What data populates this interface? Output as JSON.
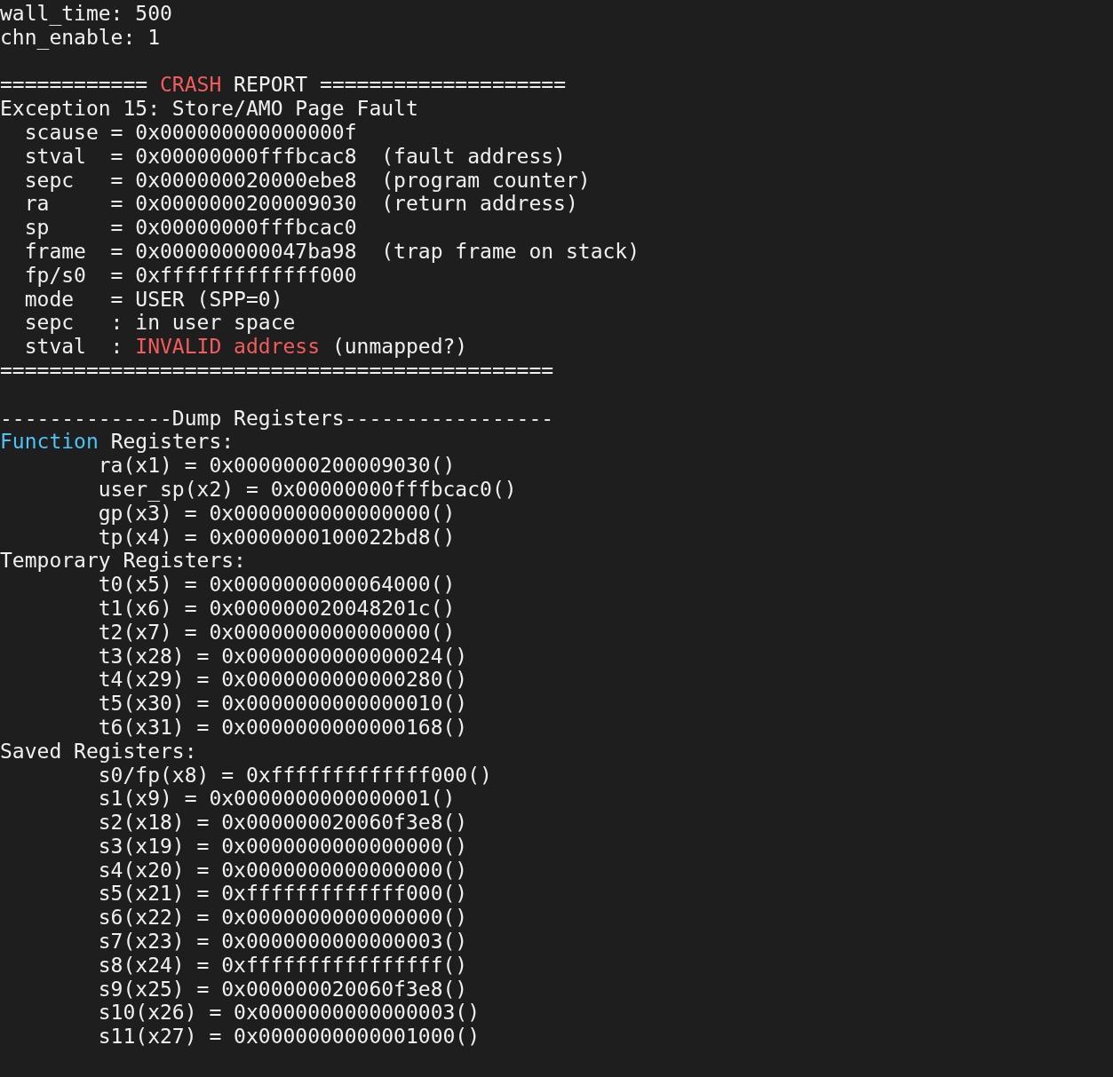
{
  "terminal": {
    "lines": [
      {
        "kind": "text",
        "segments": [
          {
            "text": "wall_time: 500"
          }
        ]
      },
      {
        "kind": "text",
        "segments": [
          {
            "text": "chn_enable: 1"
          }
        ]
      },
      {
        "kind": "blank"
      },
      {
        "kind": "text",
        "segments": [
          {
            "text": "============ "
          },
          {
            "text": "CRASH",
            "color": "#f25c5c"
          },
          {
            "text": " REPORT ===================="
          }
        ]
      },
      {
        "kind": "text",
        "segments": [
          {
            "text": "Exception 15: Store/AMO Page Fault"
          }
        ]
      },
      {
        "kind": "text",
        "segments": [
          {
            "text": "  scause = 0x000000000000000f"
          }
        ]
      },
      {
        "kind": "text",
        "segments": [
          {
            "text": "  stval  = 0x00000000fffbcac8  (fault address)"
          }
        ]
      },
      {
        "kind": "text",
        "segments": [
          {
            "text": "  sepc   = 0x000000020000ebe8  (program counter)"
          }
        ]
      },
      {
        "kind": "text",
        "segments": [
          {
            "text": "  ra     = 0x0000000200009030  (return address)"
          }
        ]
      },
      {
        "kind": "text",
        "segments": [
          {
            "text": "  sp     = 0x00000000fffbcac0"
          }
        ]
      },
      {
        "kind": "text",
        "segments": [
          {
            "text": "  frame  = 0x000000000047ba98  (trap frame on stack)"
          }
        ]
      },
      {
        "kind": "text",
        "segments": [
          {
            "text": "  fp/s0  = 0xfffffffffffff000"
          }
        ]
      },
      {
        "kind": "text",
        "segments": [
          {
            "text": "  mode   = USER (SPP=0)"
          }
        ]
      },
      {
        "kind": "text",
        "segments": [
          {
            "text": "  sepc   : in user space"
          }
        ]
      },
      {
        "kind": "text",
        "segments": [
          {
            "text": "  stval  : "
          },
          {
            "text": "INVALID address",
            "color": "#f25c5c"
          },
          {
            "text": " (unmapped?)"
          }
        ]
      },
      {
        "kind": "text",
        "segments": [
          {
            "text": "============================================="
          }
        ]
      },
      {
        "kind": "blank"
      },
      {
        "kind": "text",
        "segments": [
          {
            "text": "--------------Dump Registers-----------------"
          }
        ]
      },
      {
        "kind": "text",
        "segments": [
          {
            "text": "Function",
            "color": "#4ec3f5"
          },
          {
            "text": " Registers:"
          }
        ]
      },
      {
        "kind": "text",
        "segments": [
          {
            "text": "        ra(x1) = 0x0000000200009030()"
          }
        ]
      },
      {
        "kind": "text",
        "segments": [
          {
            "text": "        user_sp(x2) = 0x00000000fffbcac0()"
          }
        ]
      },
      {
        "kind": "text",
        "segments": [
          {
            "text": "        gp(x3) = 0x0000000000000000()"
          }
        ]
      },
      {
        "kind": "text",
        "segments": [
          {
            "text": "        tp(x4) = 0x0000000100022bd8()"
          }
        ]
      },
      {
        "kind": "text",
        "segments": [
          {
            "text": "Temporary Registers:"
          }
        ]
      },
      {
        "kind": "text",
        "segments": [
          {
            "text": "        t0(x5) = 0x0000000000064000()"
          }
        ]
      },
      {
        "kind": "text",
        "segments": [
          {
            "text": "        t1(x6) = 0x000000020048201c()"
          }
        ]
      },
      {
        "kind": "text",
        "segments": [
          {
            "text": "        t2(x7) = 0x0000000000000000()"
          }
        ]
      },
      {
        "kind": "text",
        "segments": [
          {
            "text": "        t3(x28) = 0x0000000000000024()"
          }
        ]
      },
      {
        "kind": "text",
        "segments": [
          {
            "text": "        t4(x29) = 0x0000000000000280()"
          }
        ]
      },
      {
        "kind": "text",
        "segments": [
          {
            "text": "        t5(x30) = 0x0000000000000010()"
          }
        ]
      },
      {
        "kind": "text",
        "segments": [
          {
            "text": "        t6(x31) = 0x0000000000000168()"
          }
        ]
      },
      {
        "kind": "text",
        "segments": [
          {
            "text": "Saved Registers:"
          }
        ]
      },
      {
        "kind": "text",
        "segments": [
          {
            "text": "        s0/fp(x8) = 0xfffffffffffff000()"
          }
        ]
      },
      {
        "kind": "text",
        "segments": [
          {
            "text": "        s1(x9) = 0x0000000000000001()"
          }
        ]
      },
      {
        "kind": "text",
        "segments": [
          {
            "text": "        s2(x18) = 0x000000020060f3e8()"
          }
        ]
      },
      {
        "kind": "text",
        "segments": [
          {
            "text": "        s3(x19) = 0x0000000000000000()"
          }
        ]
      },
      {
        "kind": "text",
        "segments": [
          {
            "text": "        s4(x20) = 0x0000000000000000()"
          }
        ]
      },
      {
        "kind": "text",
        "segments": [
          {
            "text": "        s5(x21) = 0xfffffffffffff000()"
          }
        ]
      },
      {
        "kind": "text",
        "segments": [
          {
            "text": "        s6(x22) = 0x0000000000000000()"
          }
        ]
      },
      {
        "kind": "text",
        "segments": [
          {
            "text": "        s7(x23) = 0x0000000000000003()"
          }
        ]
      },
      {
        "kind": "text",
        "segments": [
          {
            "text": "        s8(x24) = 0xffffffffffffffff()"
          }
        ]
      },
      {
        "kind": "text",
        "segments": [
          {
            "text": "        s9(x25) = 0x000000020060f3e8()"
          }
        ]
      },
      {
        "kind": "text",
        "segments": [
          {
            "text": "        s10(x26) = 0x0000000000000003()"
          }
        ]
      },
      {
        "kind": "text",
        "segments": [
          {
            "text": "        s11(x27) = 0x0000000000001000()"
          }
        ]
      }
    ]
  }
}
